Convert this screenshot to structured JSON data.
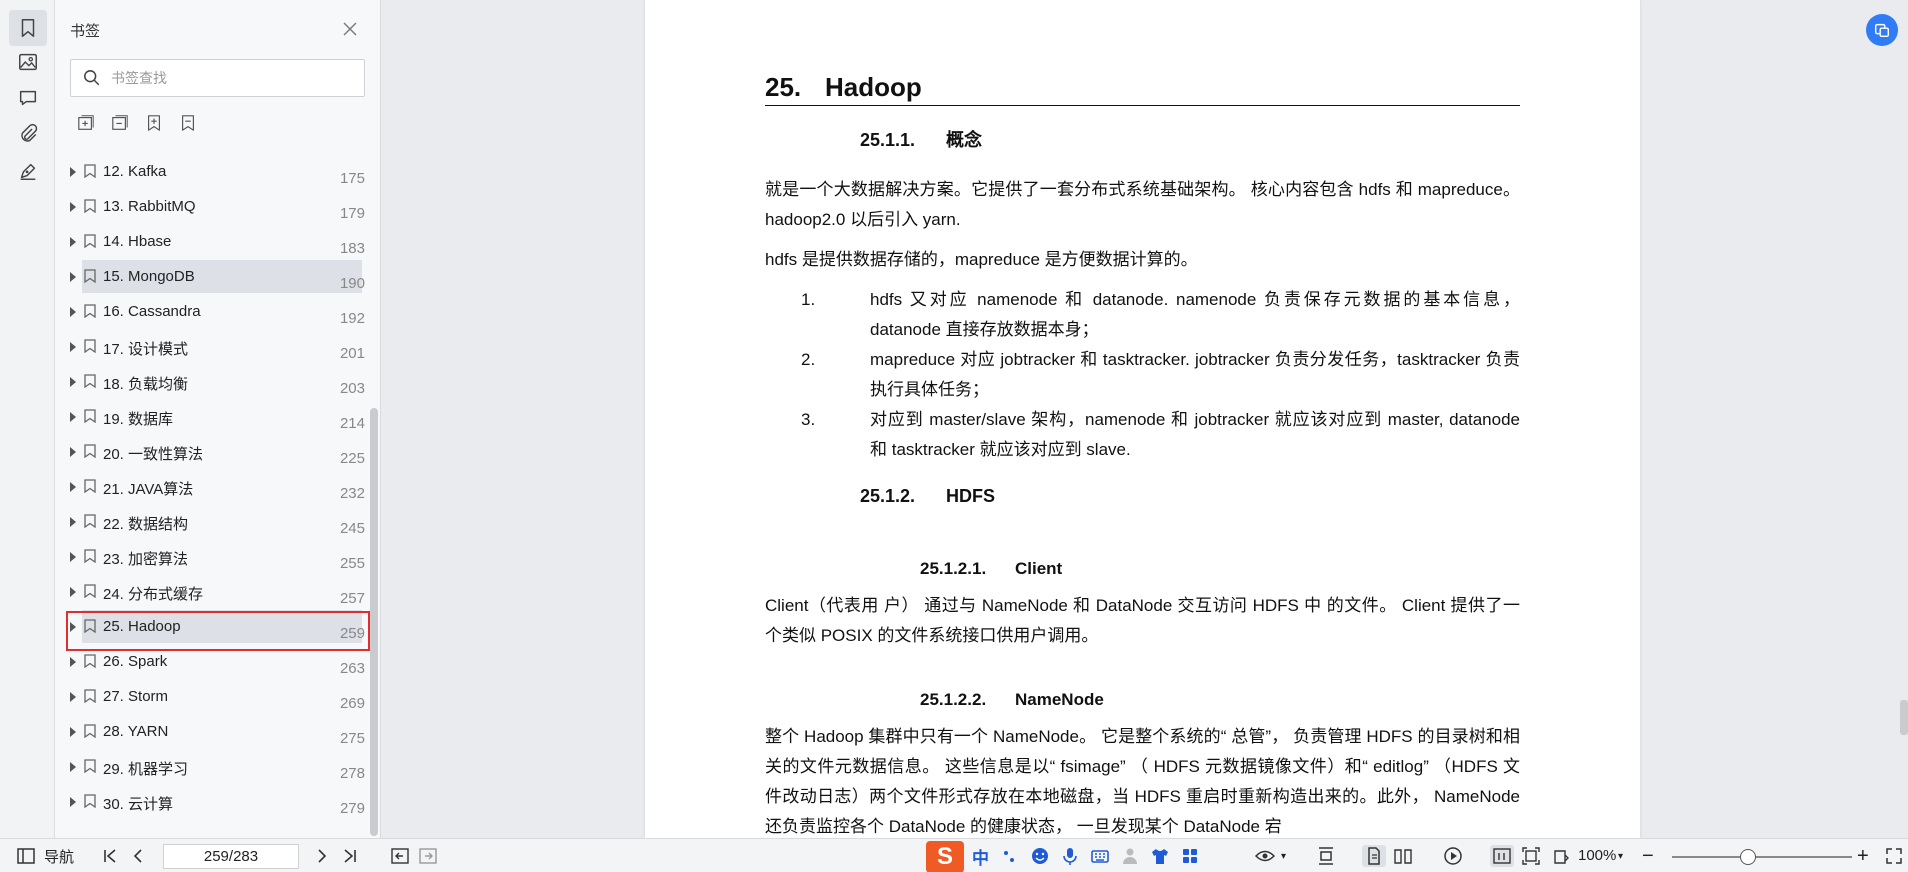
{
  "panel": {
    "title": "书签",
    "search_placeholder": "书签查找"
  },
  "bookmarks": [
    {
      "label": "12. Kafka",
      "page": "175"
    },
    {
      "label": "13. RabbitMQ",
      "page": "179"
    },
    {
      "label": "14. Hbase",
      "page": "183"
    },
    {
      "label": "15. MongoDB",
      "page": "190"
    },
    {
      "label": "16. Cassandra",
      "page": "192"
    },
    {
      "label": "17. 设计模式",
      "page": "201"
    },
    {
      "label": "18. 负载均衡",
      "page": "203"
    },
    {
      "label": "19. 数据库",
      "page": "214"
    },
    {
      "label": "20. 一致性算法",
      "page": "225"
    },
    {
      "label": "21. JAVA算法",
      "page": "232"
    },
    {
      "label": "22. 数据结构",
      "page": "245"
    },
    {
      "label": "23. 加密算法",
      "page": "255"
    },
    {
      "label": "24. 分布式缓存",
      "page": "257"
    },
    {
      "label": "25. Hadoop",
      "page": "259"
    },
    {
      "label": "26. Spark",
      "page": "263"
    },
    {
      "label": "27. Storm",
      "page": "269"
    },
    {
      "label": "28. YARN",
      "page": "275"
    },
    {
      "label": "29. 机器学习",
      "page": "278"
    },
    {
      "label": "30. 云计算",
      "page": "279"
    }
  ],
  "doc": {
    "h1_num": "25.",
    "h1_text": "Hadoop",
    "s1_num": "25.1.1.",
    "s1_text": "概念",
    "p1": "就是一个大数据解决方案。它提供了一套分布式系统基础架构。 核心内容包含 hdfs 和 mapreduce。hadoop2.0 以后引入 yarn.",
    "p2": " hdfs 是提供数据存储的，mapreduce 是方便数据计算的。",
    "list": [
      {
        "num": "1.",
        "text": "hdfs 又对应 namenode 和 datanode. namenode 负责保存元数据的基本信息，datanode 直接存放数据本身；"
      },
      {
        "num": "2.",
        "text": "mapreduce 对应 jobtracker 和 tasktracker. jobtracker 负责分发任务，tasktracker 负责执行具体任务；"
      },
      {
        "num": "3.",
        "text": "对应到 master/slave 架构，namenode 和 jobtracker 就应该对应到 master, datanode 和 tasktracker 就应该对应到 slave."
      }
    ],
    "s2_num": "25.1.2.",
    "s2_text": "HDFS",
    "s3_num": "25.1.2.1.",
    "s3_text": "Client",
    "p3": "Client（代表用 户） 通过与 NameNode 和 DataNode 交互访问 HDFS 中 的文件。 Client 提供了一个类似 POSIX 的文件系统接口供用户调用。",
    "s4_num": "25.1.2.2.",
    "s4_text": "NameNode",
    "p4": "整个 Hadoop 集群中只有一个 NameNode。 它是整个系统的“ 总管”， 负责管理 HDFS 的目录树和相关的文件元数据信息。 这些信息是以“ fsimage” （ HDFS 元数据镜像文件）和“ editlog” （HDFS 文件改动日志）两个文件形式存放在本地磁盘，当 HDFS 重启时重新构造出来的。此外， NameNode 还负责监控各个 DataNode 的健康状态， 一旦发现某个 DataNode 宕"
  },
  "status": {
    "nav_label": "导航",
    "page_value": "259/283",
    "ime_label": "S",
    "ime_mode": "中",
    "zoom": "100%",
    "zoom_fraction": 0.42
  }
}
